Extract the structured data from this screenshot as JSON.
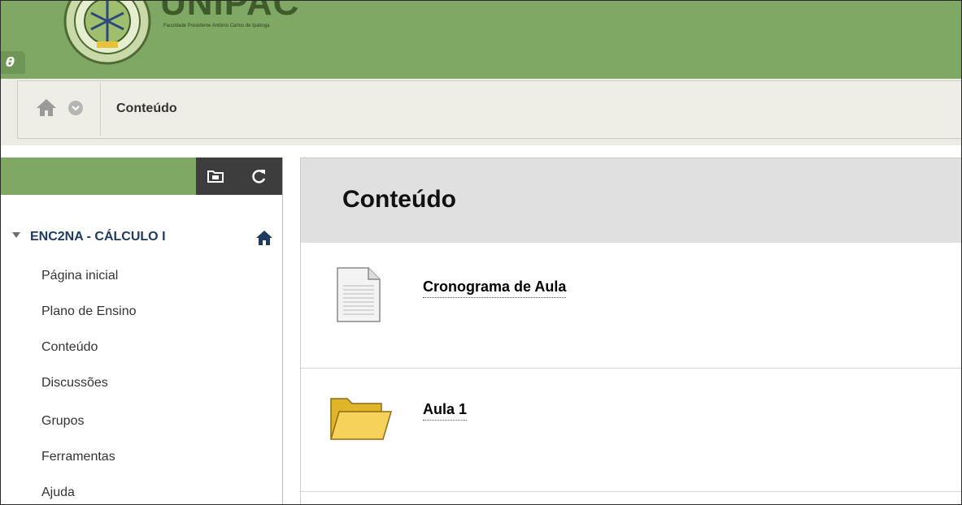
{
  "header": {
    "brand_title": "UNIPAC",
    "brand_subtitle": "Faculdade Presidente Antônio Carlos de Ipatinga",
    "edit_mode_glyph": "θ",
    "colors": {
      "header_green": "#7fa865",
      "dark_tool": "#3d3d3d",
      "course_navy": "#1f3a60"
    }
  },
  "breadcrumb": {
    "home_icon": "home-icon",
    "menu_icon": "chevron-circle-icon",
    "current": "Conteúdo"
  },
  "sidebar": {
    "tools": [
      "folder-view-icon",
      "refresh-icon"
    ],
    "course_title": "ENC2NA - CÁLCULO I",
    "items": [
      {
        "label": "Página inicial"
      },
      {
        "label": "Plano de Ensino"
      },
      {
        "label": "Conteúdo"
      },
      {
        "label": "Discussões"
      },
      {
        "label": "Grupos"
      },
      {
        "label": "Ferramentas"
      },
      {
        "label": "Ajuda"
      }
    ]
  },
  "content": {
    "title": "Conteúdo",
    "items": [
      {
        "label": "Cronograma de Aula",
        "icon": "document-icon"
      },
      {
        "label": "Aula 1",
        "icon": "folder-icon"
      }
    ]
  }
}
